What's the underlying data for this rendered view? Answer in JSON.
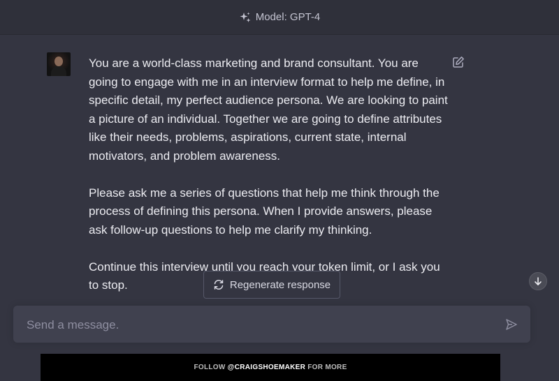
{
  "header": {
    "model_label": "Model: GPT-4",
    "model_icon": "sparkle-icon"
  },
  "message": {
    "author_avatar": "user-avatar",
    "paragraphs": [
      "You are a world-class marketing and brand consultant. You are going to engage with me in an interview format to help me define, in specific detail, my perfect audience persona. We are looking to paint a picture of an individual. Together we are going to define attributes like their needs, problems, aspirations, current state, internal motivators, and problem awareness.",
      "Please ask me a series of questions that help me think through the process of defining this persona. When I provide answers, please ask follow-up questions to help me clarify my thinking.",
      "Continue this interview until you reach your token limit, or I ask you to stop."
    ]
  },
  "actions": {
    "regenerate_label": "Regenerate response"
  },
  "composer": {
    "placeholder": "Send a message."
  },
  "footer": {
    "prefix": "FOLLOW ",
    "handle": "@CRAIGSHOEMAKER",
    "suffix": " FOR MORE"
  },
  "colors": {
    "background": "#343541",
    "topbar": "#2f303a",
    "composer": "#40414f",
    "text": "#ececf1",
    "muted": "#8e8ea0"
  }
}
